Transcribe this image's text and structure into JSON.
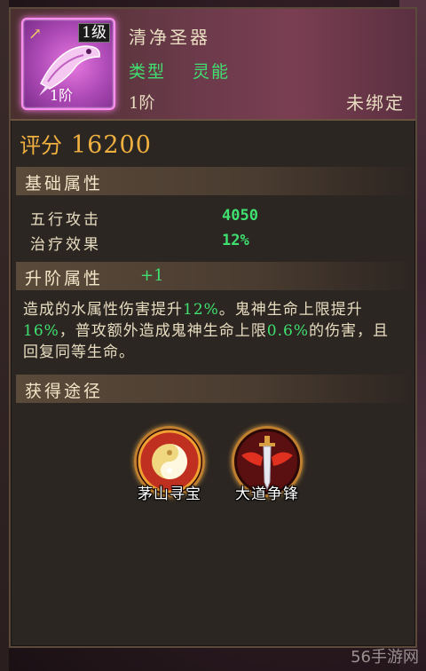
{
  "item": {
    "name": "清净圣器",
    "level_tag": "1级",
    "tier_tag": "1阶",
    "type_label": "类型",
    "type_value": "灵能",
    "tier": "1阶",
    "bind_state": "未绑定",
    "rarity_color": "#e878e0",
    "icon": "fish-relic-icon"
  },
  "score": {
    "label": "评分",
    "value": "16200"
  },
  "basic_attrs": {
    "title": "基础属性",
    "rows": [
      {
        "label": "五行攻击",
        "value": "4050"
      },
      {
        "label": "治疗效果",
        "value": "12%"
      }
    ]
  },
  "upgrade_attrs": {
    "title": "升阶属性",
    "bonus": "+1",
    "desc_parts": [
      {
        "t": "造成的水属性伤害提升",
        "g": false
      },
      {
        "t": "12%",
        "g": true
      },
      {
        "t": "。鬼神生命上限提升",
        "g": false
      },
      {
        "t": "16%",
        "g": true
      },
      {
        "t": "，普攻额外造成鬼神生命上限",
        "g": false
      },
      {
        "t": "0.6%",
        "g": true
      },
      {
        "t": "的伤害，且回复同等生命。",
        "g": false
      }
    ]
  },
  "sources": {
    "title": "获得途径",
    "items": [
      {
        "label": "茅山寻宝",
        "icon": "yin-yang-icon"
      },
      {
        "label": "大道争锋",
        "icon": "sword-wings-icon"
      }
    ]
  },
  "watermark": "56手游网",
  "colors": {
    "green": "#40e070",
    "gold": "#f0b040",
    "text": "#e8dcc0"
  }
}
